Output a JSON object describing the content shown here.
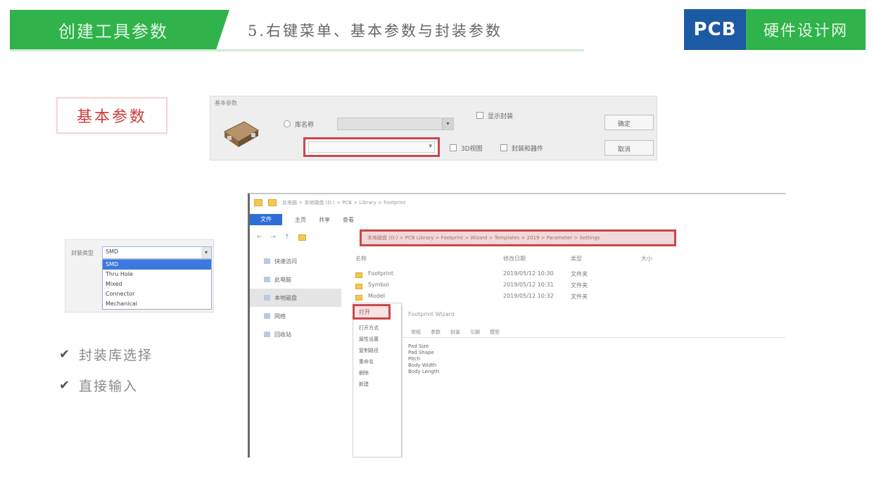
{
  "header": {
    "tag": "创建工具参数",
    "title": "5.右键菜单、基本参数与封装参数",
    "logo_mark": "PCB",
    "logo_text": "硬件设计网"
  },
  "section_label": "基本参数",
  "prop_panel": {
    "caption": "基本参数",
    "radio1_label": "库名称",
    "checkbox1_label": "显示封装",
    "checkbox2_label": "3D视图",
    "checkbox3_label": "封装和器件",
    "button1": "确定",
    "button2": "取消"
  },
  "dropdown": {
    "label": "封装类型",
    "selected": "SMD",
    "items": [
      "SMD",
      "Thru Hole",
      "Mixed",
      "Connector",
      "Mechanical"
    ]
  },
  "bullets": [
    "封装库选择",
    "直接输入"
  ],
  "explorer": {
    "path": "此电脑 > 本地磁盘 (D:) > PCB > Library > Footprint",
    "file_tab": "文件",
    "tabs": [
      "主页",
      "共享",
      "查看"
    ],
    "address": "本地磁盘 (D:) > PCB Library > Footprint > Wizard > Templates > 2019 > Parameter > Settings",
    "sidebar": [
      "快速访问",
      "此电脑",
      "本地磁盘",
      "网络",
      "回收站"
    ],
    "columns": [
      "名称",
      "修改日期",
      "类型",
      "大小"
    ],
    "rows": [
      {
        "name": "Footprint",
        "date": "2019/05/12 10:30",
        "type": "文件夹"
      },
      {
        "name": "Symbol",
        "date": "2019/05/12 10:31",
        "type": "文件夹"
      },
      {
        "name": "Model",
        "date": "2019/05/12 10:32",
        "type": "文件夹"
      }
    ],
    "context_highlight": "打开",
    "context_items": [
      "打开方式",
      "属性设置",
      "复制路径",
      "重命名",
      "删除",
      "新建"
    ],
    "sub_head": "Footprint Wizard",
    "sub_tabs": [
      "常规",
      "参数",
      "封装",
      "引脚",
      "模型"
    ],
    "sub_items": [
      "Pad Size",
      "Pad Shape",
      "Pitch",
      "Body Width",
      "Body Length"
    ]
  }
}
